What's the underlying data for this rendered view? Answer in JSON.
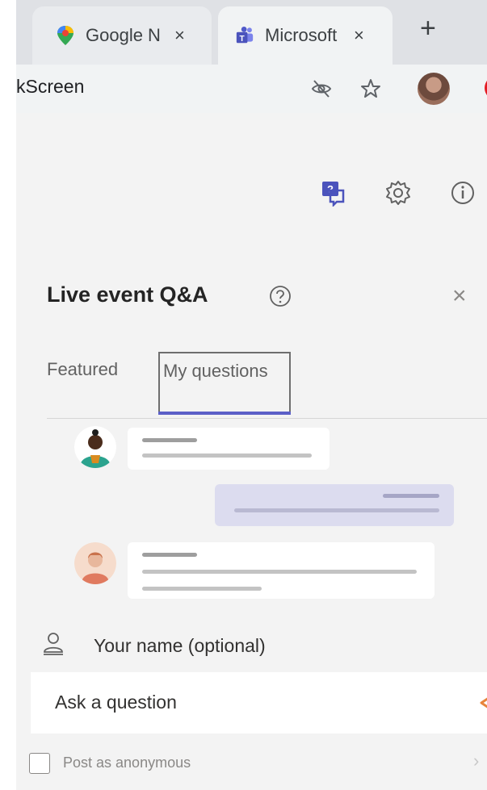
{
  "browser": {
    "tabs": [
      {
        "title": "Google N",
        "close": "×",
        "active": false
      },
      {
        "title": "Microsoft",
        "close": "×",
        "active": true
      }
    ],
    "new_tab": "+",
    "url_fragment": "kScreen"
  },
  "panel": {
    "title": "Live event Q&A",
    "close": "×",
    "tabs": {
      "featured": "Featured",
      "my_questions": "My questions"
    }
  },
  "compose": {
    "name_placeholder": "Your name (optional)",
    "question_placeholder": "Ask a question",
    "anonymous_label": "Post as anonymous"
  },
  "colors": {
    "accent": "#5b5fc7",
    "arrow": "#e8843c",
    "own_bubble": "#dcdcef"
  }
}
